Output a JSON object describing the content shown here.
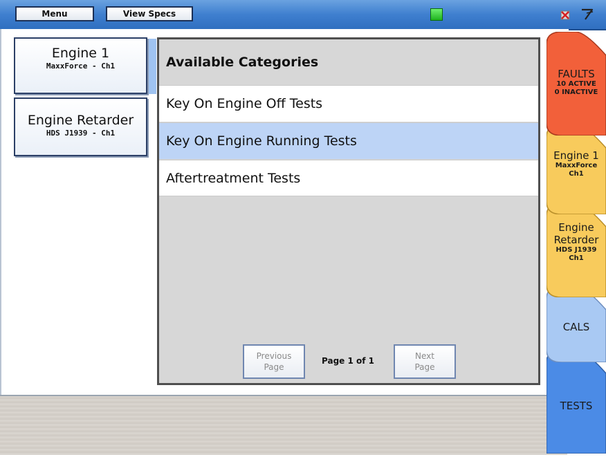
{
  "toolbar": {
    "menu_label": "Menu",
    "view_specs_label": "View Specs",
    "status_color": "#2ecc2e"
  },
  "modules": [
    {
      "name": "Engine 1",
      "detail": "MaxxForce - Ch1"
    },
    {
      "name": "Engine Retarder",
      "detail": "HDS J1939 - Ch1"
    }
  ],
  "categories": {
    "title": "Available Categories",
    "items": [
      {
        "label": "Key On Engine Off Tests",
        "selected": false
      },
      {
        "label": "Key On Engine Running Tests",
        "selected": true
      },
      {
        "label": "Aftertreatment Tests",
        "selected": false
      }
    ]
  },
  "pagination": {
    "previous_label": "Previous Page",
    "next_label": "Next Page",
    "page_label": "Page 1 of 1"
  },
  "tabs": {
    "faults": {
      "title": "FAULTS",
      "line1": "10 ACTIVE",
      "line2": "0 INACTIVE",
      "color": "#f2603a"
    },
    "engine1": {
      "title": "Engine 1",
      "line1": "MaxxForce",
      "line2": "Ch1",
      "color": "#f8cb5c"
    },
    "retarder": {
      "title1": "Engine",
      "title2": "Retarder",
      "line1": "HDS J1939",
      "line2": "Ch1",
      "color": "#f8cb5c"
    },
    "cals": {
      "title": "CALS",
      "color": "#a9c9f3"
    },
    "tests": {
      "title": "TESTS",
      "color": "#4b8be6"
    }
  },
  "icons": {
    "close": "close-icon",
    "tool": "wrench-icon"
  }
}
